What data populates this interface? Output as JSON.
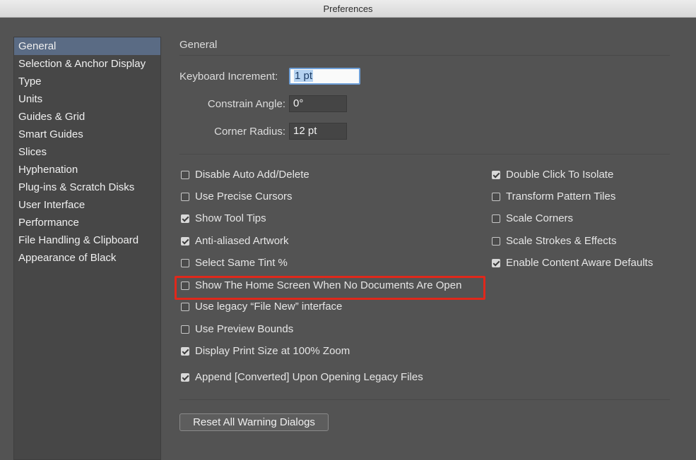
{
  "window": {
    "title": "Preferences"
  },
  "sidebar": {
    "items": [
      {
        "label": "General",
        "selected": true
      },
      {
        "label": "Selection & Anchor Display"
      },
      {
        "label": "Type"
      },
      {
        "label": "Units"
      },
      {
        "label": "Guides & Grid"
      },
      {
        "label": "Smart Guides"
      },
      {
        "label": "Slices"
      },
      {
        "label": "Hyphenation"
      },
      {
        "label": "Plug-ins & Scratch Disks"
      },
      {
        "label": "User Interface"
      },
      {
        "label": "Performance"
      },
      {
        "label": "File Handling & Clipboard"
      },
      {
        "label": "Appearance of Black"
      }
    ]
  },
  "general": {
    "title": "General",
    "fields": {
      "keyboard_increment": {
        "label": "Keyboard Increment:",
        "value": "1 pt"
      },
      "constrain_angle": {
        "label": "Constrain Angle:",
        "value": "0°"
      },
      "corner_radius": {
        "label": "Corner Radius:",
        "value": "12 pt"
      }
    },
    "left_options": [
      {
        "label": "Disable Auto Add/Delete",
        "checked": false
      },
      {
        "label": "Use Precise Cursors",
        "checked": false
      },
      {
        "label": "Show Tool Tips",
        "checked": true
      },
      {
        "label": "Anti-aliased Artwork",
        "checked": true
      },
      {
        "label": "Select Same Tint %",
        "checked": false
      },
      {
        "label": "Show The Home Screen When No Documents Are Open",
        "checked": false
      },
      {
        "label": "Use legacy “File New” interface",
        "checked": false
      },
      {
        "label": "Use Preview Bounds",
        "checked": false
      },
      {
        "label": "Display Print Size at 100% Zoom",
        "checked": true
      },
      {
        "label": "Append [Converted] Upon Opening Legacy Files",
        "checked": true
      }
    ],
    "right_options": [
      {
        "label": "Double Click To Isolate",
        "checked": true
      },
      {
        "label": "Transform Pattern Tiles",
        "checked": false
      },
      {
        "label": "Scale Corners",
        "checked": false
      },
      {
        "label": "Scale Strokes & Effects",
        "checked": false
      },
      {
        "label": "Enable Content Aware Defaults",
        "checked": true
      }
    ],
    "reset_button": "Reset All Warning Dialogs"
  },
  "colors": {
    "highlight": "#e0281b",
    "selection": "#5a6b84",
    "panel": "#535353"
  }
}
